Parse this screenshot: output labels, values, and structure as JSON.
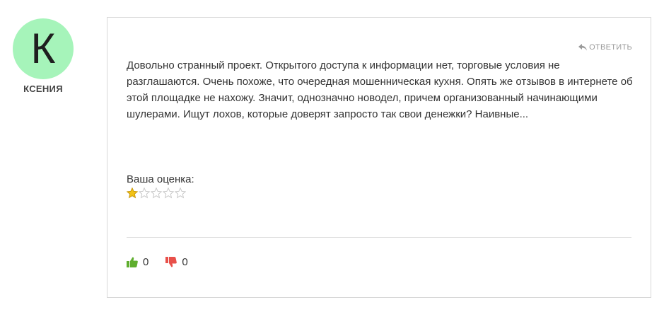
{
  "author": {
    "initial": "К",
    "name": "КСЕНИЯ",
    "avatar_color": "#a6f4ba"
  },
  "review": {
    "reply_label": "ОТВЕТИТЬ",
    "text": "Довольно странный проект. Открытого доступа к информации нет, торговые условия не разглашаются. Очень похоже, что очередная мошенническая кухня. Опять же отзывов в интернете об этой площадке не нахожу. Значит, однозначно новодел, причем организованный начинающими шулерами. Ищут лохов, которые доверят запросто так свои денежки? Наивные...",
    "rating_label": "Ваша оценка:",
    "rating": 1,
    "rating_max": 5
  },
  "votes": {
    "likes": "0",
    "dislikes": "0",
    "like_color": "#5fae2e",
    "dislike_color": "#e8504a"
  },
  "icons": {
    "reply": "reply-arrow-icon",
    "like": "thumbs-up-icon",
    "dislike": "thumbs-down-icon",
    "star": "star-icon"
  }
}
